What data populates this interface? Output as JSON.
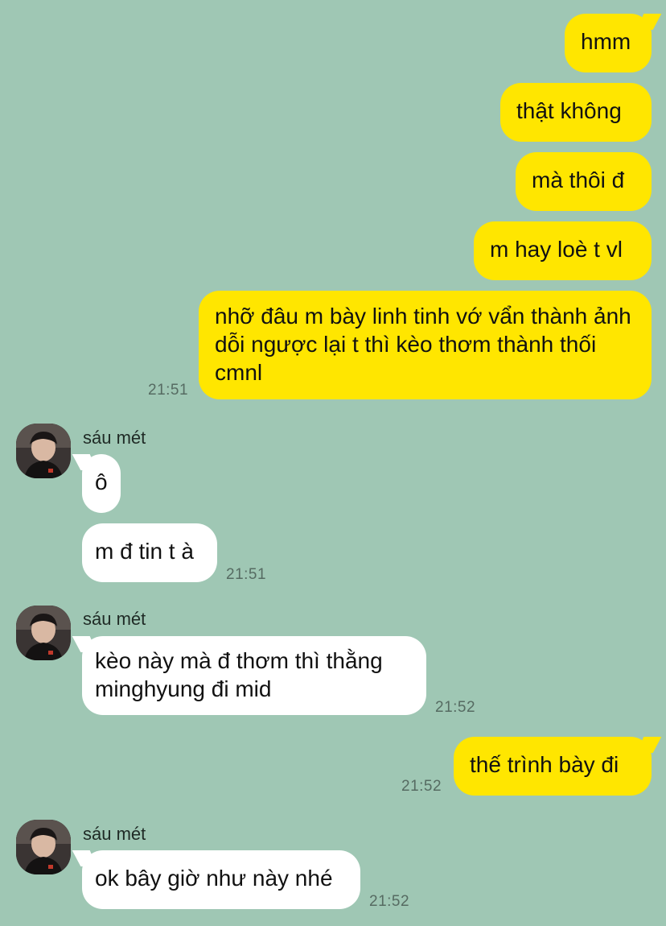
{
  "outgoing_1": {
    "messages": [
      "hmm",
      "thật không",
      "mà thôi đ",
      "m hay loè t vl",
      "nhỡ đâu m bày linh tinh vớ vẩn thành ảnh dỗi ngược lại t thì kèo thơm thành thối cmnl"
    ],
    "time": "21:51"
  },
  "incoming_1": {
    "sender": "sáu mét",
    "messages": [
      "ô",
      "m đ tin t à"
    ],
    "time": "21:51"
  },
  "incoming_2": {
    "sender": "sáu mét",
    "messages": [
      "kèo này mà đ thơm thì thằng minghyung đi mid"
    ],
    "time": "21:52"
  },
  "outgoing_2": {
    "messages": [
      "thế trình bày đi"
    ],
    "time": "21:52"
  },
  "incoming_3": {
    "sender": "sáu mét",
    "messages": [
      "ok bây giờ như này nhé"
    ],
    "time": "21:52"
  },
  "colors": {
    "background": "#9fc7b4",
    "outgoing_bubble": "#ffe600",
    "incoming_bubble": "#ffffff"
  }
}
